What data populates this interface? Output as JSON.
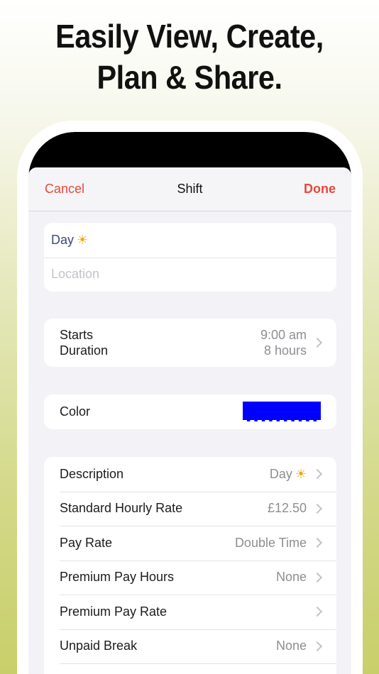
{
  "headline": {
    "line1": "Easily View, Create,",
    "line2": "Plan & Share."
  },
  "nav": {
    "cancel": "Cancel",
    "title": "Shift",
    "done": "Done"
  },
  "name_group": {
    "title_value": "Day",
    "title_icon": "sun-icon",
    "location_placeholder": "Location"
  },
  "time_group": {
    "starts_label": "Starts",
    "duration_label": "Duration",
    "starts_value": "9:00 am",
    "duration_value": "8 hours"
  },
  "color_group": {
    "label": "Color",
    "swatch_color": "#0000ff"
  },
  "details": [
    {
      "label": "Description",
      "value": "Day",
      "icon": "sun-icon"
    },
    {
      "label": "Standard Hourly Rate",
      "value": "£12.50"
    },
    {
      "label": "Pay Rate",
      "value": "Double Time"
    },
    {
      "label": "Premium Pay Hours",
      "value": "None"
    },
    {
      "label": "Premium Pay Rate",
      "value": ""
    },
    {
      "label": "Unpaid Break",
      "value": "None"
    }
  ],
  "colors": {
    "accent": "#e8473a",
    "background_group": "#ffffff",
    "screen_bg": "#f2f2f7"
  }
}
